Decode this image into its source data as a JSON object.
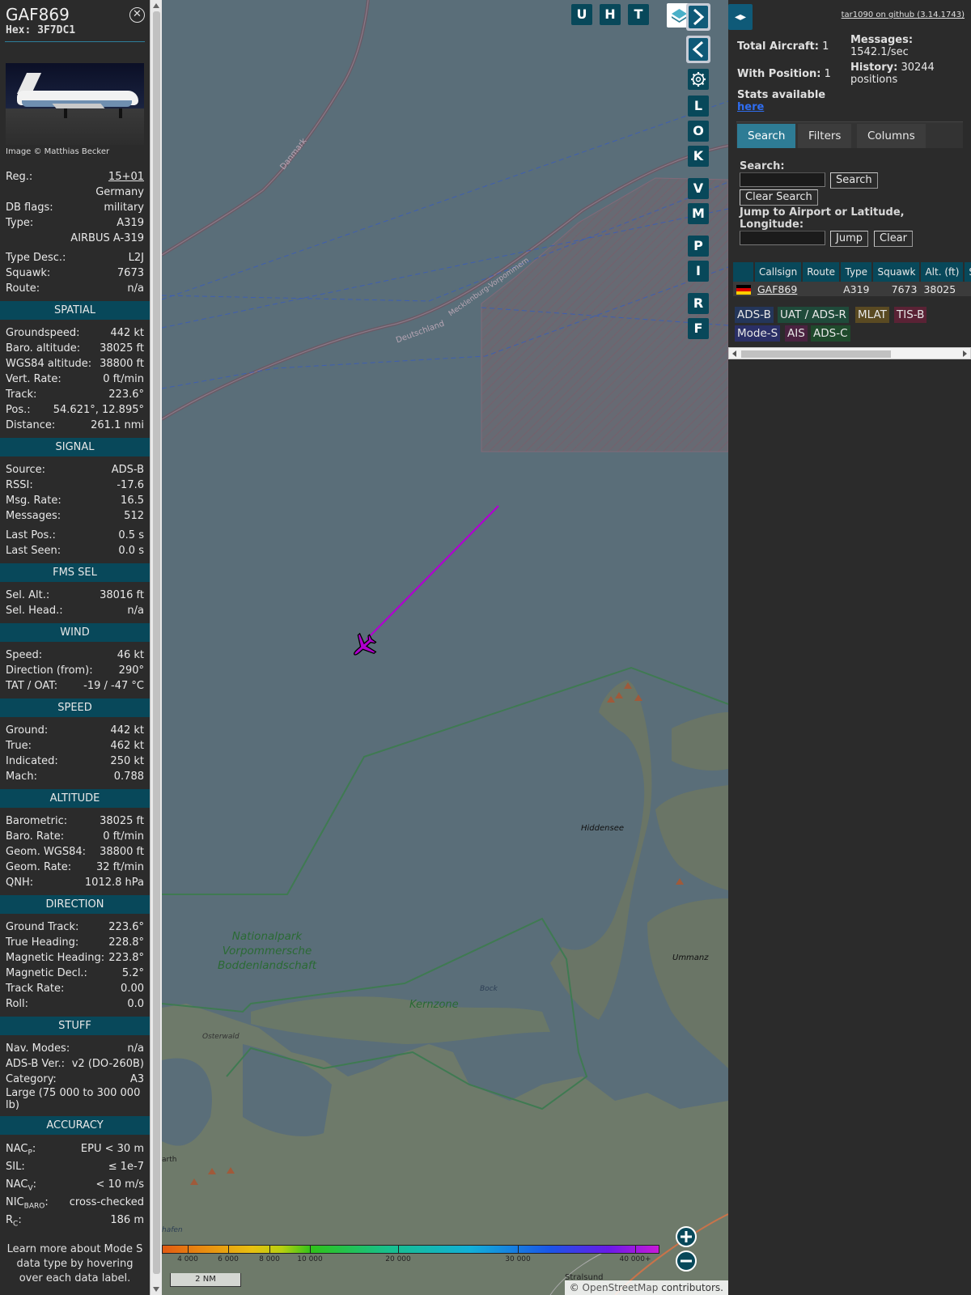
{
  "sidebar": {
    "callsign": "GAF869",
    "hex_label": "Hex: 3F7DC1",
    "close_icon": "close-circle-icon",
    "image_credit": "Image © Matthias Becker",
    "info": {
      "reg_label": "Reg.:",
      "reg_value": "15+01",
      "country": "Germany",
      "dbflags_label": "DB flags:",
      "dbflags_value": "military",
      "type_label": "Type:",
      "type_value": "A319",
      "type_name": "AIRBUS A-319",
      "typedesc_label": "Type Desc.:",
      "typedesc_value": "L2J",
      "squawk_label": "Squawk:",
      "squawk_value": "7673",
      "route_label": "Route:",
      "route_value": "n/a"
    },
    "spatial": {
      "title": "SPATIAL",
      "rows": [
        {
          "label": "Groundspeed:",
          "value": "442 kt"
        },
        {
          "label": "Baro. altitude:",
          "value": "38025 ft"
        },
        {
          "label": "WGS84 altitude:",
          "value": "38800 ft"
        },
        {
          "label": "Vert. Rate:",
          "value": "0 ft/min"
        },
        {
          "label": "Track:",
          "value": "223.6°"
        },
        {
          "label": "Pos.:",
          "value": "54.621°, 12.895°"
        },
        {
          "label": "Distance:",
          "value": "261.1 nmi"
        }
      ]
    },
    "signal": {
      "title": "SIGNAL",
      "rows": [
        {
          "label": "Source:",
          "value": "ADS-B"
        },
        {
          "label": "RSSI:",
          "value": "-17.6"
        },
        {
          "label": "Msg. Rate:",
          "value": "16.5"
        },
        {
          "label": "Messages:",
          "value": "512"
        }
      ],
      "rows2": [
        {
          "label": "Last Pos.:",
          "value": "0.5 s"
        },
        {
          "label": "Last Seen:",
          "value": "0.0 s"
        }
      ]
    },
    "fms": {
      "title": "FMS SEL",
      "rows": [
        {
          "label": "Sel. Alt.:",
          "value": "38016 ft"
        },
        {
          "label": "Sel. Head.:",
          "value": "n/a"
        }
      ]
    },
    "wind": {
      "title": "WIND",
      "rows": [
        {
          "label": "Speed:",
          "value": "46 kt"
        },
        {
          "label": "Direction (from):",
          "value": "290°"
        },
        {
          "label": "TAT / OAT:",
          "value": "-19 / -47 °C"
        }
      ]
    },
    "speed": {
      "title": "SPEED",
      "rows": [
        {
          "label": "Ground:",
          "value": "442 kt"
        },
        {
          "label": "True:",
          "value": "462 kt"
        },
        {
          "label": "Indicated:",
          "value": "250 kt"
        },
        {
          "label": "Mach:",
          "value": "0.788"
        }
      ]
    },
    "altitude": {
      "title": "ALTITUDE",
      "rows": [
        {
          "label": "Barometric:",
          "value": "38025 ft"
        },
        {
          "label": "Baro. Rate:",
          "value": "0 ft/min"
        },
        {
          "label": "Geom. WGS84:",
          "value": "38800 ft"
        },
        {
          "label": "Geom. Rate:",
          "value": "32 ft/min"
        },
        {
          "label": "QNH:",
          "value": "1012.8 hPa"
        }
      ]
    },
    "direction": {
      "title": "DIRECTION",
      "rows": [
        {
          "label": "Ground Track:",
          "value": "223.6°"
        },
        {
          "label": "True Heading:",
          "value": "228.8°"
        },
        {
          "label": "Magnetic Heading:",
          "value": "223.8°"
        },
        {
          "label": "Magnetic Decl.:",
          "value": "5.2°"
        },
        {
          "label": "Track Rate:",
          "value": "0.00"
        },
        {
          "label": "Roll:",
          "value": "0.0"
        }
      ]
    },
    "stuff": {
      "title": "STUFF",
      "rows": [
        {
          "label": "Nav. Modes:",
          "value": "n/a"
        },
        {
          "label": "ADS-B Ver.:",
          "value": "v2 (DO-260B)"
        },
        {
          "label": "Category:",
          "value": "A3"
        }
      ],
      "category_desc": "Large (75 000 to 300 000 lb)"
    },
    "accuracy": {
      "title": "ACCURACY",
      "nacp_label": "NAC",
      "nacp_sub": "P",
      "nacp_value": "EPU < 30 m",
      "sil_label": "SIL:",
      "sil_value": "≤ 1e-7",
      "nacv_label": "NAC",
      "nacv_sub": "V",
      "nacv_value": "< 10 m/s",
      "nic_label": "NIC",
      "nic_sub": "BARO",
      "nic_value": "cross-checked",
      "rc_label": "R",
      "rc_sub": "C",
      "rc_value": "186 m"
    },
    "footer_note": "Learn more about Mode S data type by hovering over each data label."
  },
  "map": {
    "toolbar_buttons": [
      "U",
      "H",
      "T"
    ],
    "side_buttons": [
      "L",
      "O",
      "K",
      "V",
      "M",
      "P",
      "I",
      "R",
      "F"
    ],
    "nav_forward_icon": "chevron-right-icon",
    "nav_back_icon": "chevron-left-icon",
    "settings_icon": "gear-icon",
    "layers_icon": "layers-icon",
    "labels": {
      "danmark": "Danmark",
      "deutschland": "Deutschland",
      "mecklenburg": "Mecklenburg-Vorpommern",
      "hiddensee": "Hiddensee",
      "ummanz": "Ummanz",
      "nationalpark_line1": "Nationalpark",
      "nationalpark_line2": "Vorpommersche",
      "nationalpark_line3": "Boddenlandschaft",
      "kernzone": "Kernzone",
      "bock": "Bock",
      "osterwald": "Osterwald",
      "stralsund": "Stralsund",
      "arth": "arth",
      "hafen": "hafen"
    },
    "altitude_scale": [
      "4 000",
      "6 000",
      "8 000",
      "10 000",
      "20 000",
      "30 000",
      "40 000+"
    ],
    "scale_label": "2 NM",
    "zoom_in": "+",
    "zoom_out": "−",
    "attribution_prefix": "©",
    "attribution_link": "OpenStreetMap",
    "attribution_suffix": "contributors."
  },
  "panel": {
    "split_icon": "split-arrows-icon",
    "github_link": "tar1090 on github (3.14.1743)",
    "total_label": "Total Aircraft:",
    "total_value": "1",
    "position_label": "With Position:",
    "position_value": "1",
    "messages_label": "Messages:",
    "messages_value": "1542.1/sec",
    "history_label": "History:",
    "history_value": "30244",
    "history_unit": "positions",
    "stats_label": "Stats available",
    "stats_link": "here",
    "tabs": [
      "Search",
      "Filters",
      "Columns"
    ],
    "search_label": "Search:",
    "search_button": "Search",
    "clear_search_button": "Clear Search",
    "jump_label": "Jump to Airport or Latitude, Longitude:",
    "jump_button": "Jump",
    "clear_button": "Clear",
    "table": {
      "headers": [
        "",
        "Callsign",
        "Route",
        "Type",
        "Squawk",
        "Alt. (ft)",
        "Spd."
      ],
      "rows": [
        {
          "flag": "germany-flag-icon",
          "callsign": "GAF869",
          "route": "",
          "type": "A319",
          "squawk": "7673",
          "alt": "38025",
          "spd": ""
        }
      ]
    },
    "sources": [
      {
        "label": "ADS-B",
        "color": "#24365a"
      },
      {
        "label": "UAT / ADS-R",
        "color": "#1f4a3a"
      },
      {
        "label": "MLAT",
        "color": "#5a4a22"
      },
      {
        "label": "TIS-B",
        "color": "#5a2235"
      },
      {
        "label": "Mode-S",
        "color": "#2a2f66"
      },
      {
        "label": "AIS",
        "color": "#4a2240"
      },
      {
        "label": "ADS-C",
        "color": "#1f4a2c"
      }
    ]
  },
  "colors": {
    "section_bg": "#08485a",
    "accent": "#2e7c95",
    "track": "#b000d0"
  }
}
